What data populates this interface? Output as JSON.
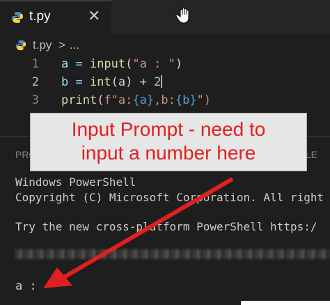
{
  "tab": {
    "label": "t.py",
    "close": "✕"
  },
  "breadcrumb": {
    "file": "t.py",
    "separator": ">",
    "more": "..."
  },
  "code": [
    {
      "line": "1",
      "parts": [
        "a = ",
        "input",
        "(",
        "\"a : \"",
        ")"
      ]
    },
    {
      "line": "2",
      "parts": [
        "b = ",
        "int",
        "(a) + ",
        "2"
      ]
    },
    {
      "line": "3",
      "parts": [
        "print",
        "(",
        "f\"a:",
        "{a}",
        ",b:",
        "{b}",
        "\")"
      ]
    }
  ],
  "panel": {
    "left_tab": "PROBLEMS",
    "right_tab": "OLE"
  },
  "callout": {
    "line1": "Input Prompt - need to",
    "line2": "input a number here"
  },
  "terminal": {
    "line1": "Windows PowerShell",
    "line2": "Copyright (C) Microsoft Corporation. All right",
    "line3": "Try the new cross-platform PowerShell https:/",
    "prompt": "a : "
  },
  "colors": {
    "callout_text": "#e02020",
    "arrow": "#e02020",
    "editor_bg": "#1e1e1e"
  }
}
